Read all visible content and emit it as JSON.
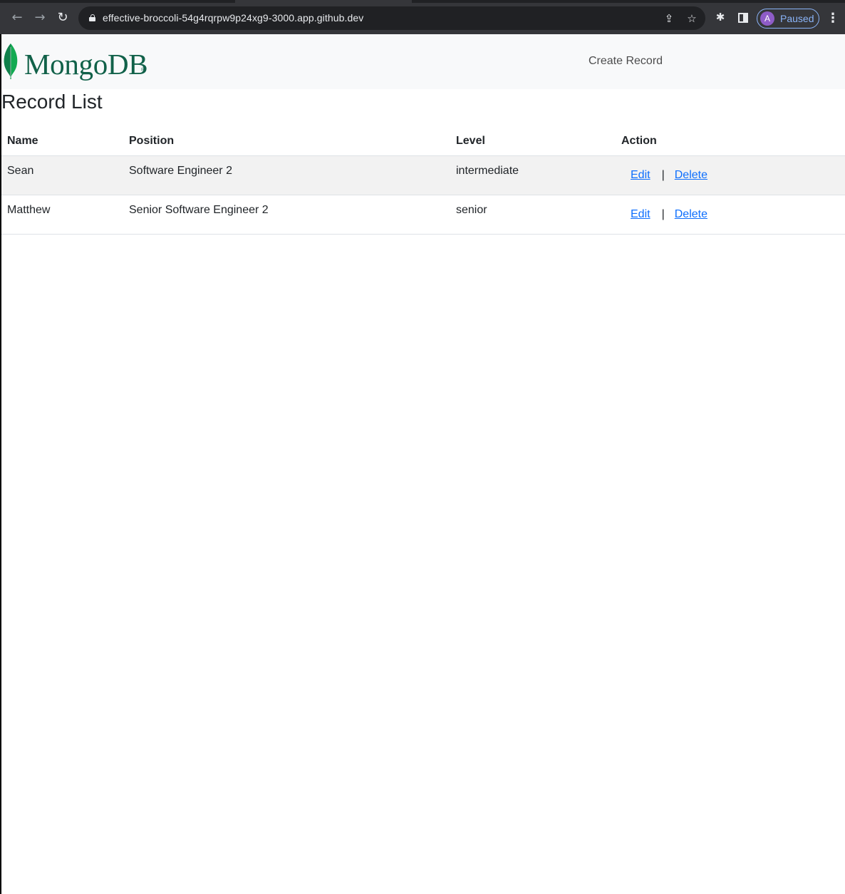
{
  "browser": {
    "url": "effective-broccoli-54g4rqrpw9p24xg9-3000.app.github.dev",
    "profile_initial": "A",
    "profile_status": "Paused",
    "icons": {
      "back": "back-arrow-icon",
      "forward": "forward-arrow-icon",
      "reload": "reload-icon",
      "lock": "lock-icon",
      "share": "share-icon",
      "bookmark": "star-icon",
      "extensions": "puzzle-icon",
      "side_panel": "side-panel-icon",
      "menu": "kebab-menu-icon"
    }
  },
  "navbar": {
    "brand": "MongoDB",
    "brand_mark": "®",
    "create_link": "Create Record",
    "brand_color": "#116149",
    "leaf_color": "#13aa52"
  },
  "main": {
    "title": "Record List",
    "table": {
      "headers": [
        "Name",
        "Position",
        "Level",
        "Action"
      ],
      "rows": [
        {
          "name": "Sean",
          "position": "Software Engineer 2",
          "level": "intermediate",
          "edit": "Edit",
          "separator": "|",
          "delete": "Delete"
        },
        {
          "name": "Matthew",
          "position": "Senior Software Engineer 2",
          "level": "senior",
          "edit": "Edit",
          "separator": "|",
          "delete": "Delete"
        }
      ]
    },
    "link_color": "#0d6efd"
  }
}
